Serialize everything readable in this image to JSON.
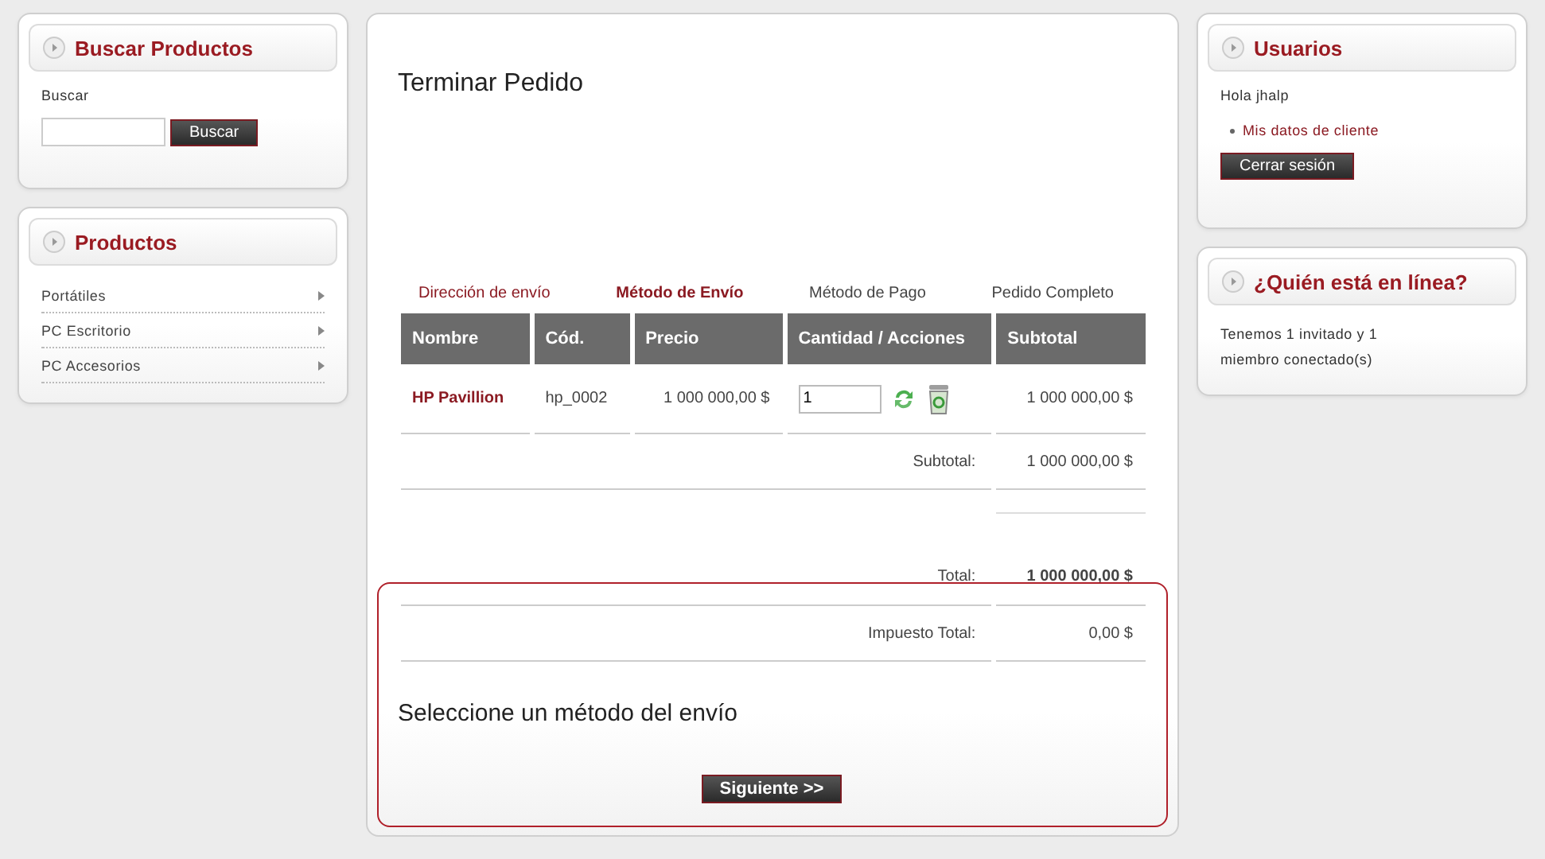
{
  "left_sidebar": {
    "search_box": {
      "title": "Buscar Productos",
      "label": "Buscar",
      "button": "Buscar"
    },
    "products_box": {
      "title": "Productos",
      "items": [
        {
          "label": "Portátiles"
        },
        {
          "label": "PC Escritorio"
        },
        {
          "label": "PC Accesorios"
        }
      ]
    }
  },
  "main": {
    "title": "Terminar Pedido",
    "steps": [
      {
        "label": "Dirección de envío",
        "completed": true,
        "selected": false
      },
      {
        "label": "Método de Envío",
        "completed": true,
        "selected": true
      },
      {
        "label": "Método de Pago",
        "completed": false,
        "selected": false
      },
      {
        "label": "Pedido Completo",
        "completed": false,
        "selected": false
      }
    ],
    "table": {
      "columns": [
        "Nombre",
        "Cód.",
        "Precio",
        "Cantidad / Acciones",
        "Subtotal"
      ],
      "rows": [
        {
          "name": "HP Pavillion",
          "code": "hp_0002",
          "price": "1 000 000,00 $",
          "quantity": "1",
          "subtotal": "1 000 000,00 $"
        }
      ]
    },
    "totals": [
      {
        "kind": "subtotal",
        "label": "Subtotal:",
        "value": "1 000 000,00 $"
      },
      {
        "kind": "spacer"
      },
      {
        "kind": "total",
        "label": "Total:",
        "value": "1 000 000,00 $"
      },
      {
        "kind": "tax",
        "label": "Impuesto Total:",
        "value": "0,00 $"
      }
    ],
    "section_heading": "Seleccione un método del envío",
    "next_button": "Siguiente >>"
  },
  "right_sidebar": {
    "users_box": {
      "title": "Usuarios",
      "greeting": "Hola jhalp",
      "links": [
        "Mis datos de cliente"
      ],
      "button": "Cerrar sesión"
    },
    "online_box": {
      "title": "¿Quién está en línea?",
      "text": "Tenemos 1 invitado y 1 miembro conectado(s)"
    }
  }
}
